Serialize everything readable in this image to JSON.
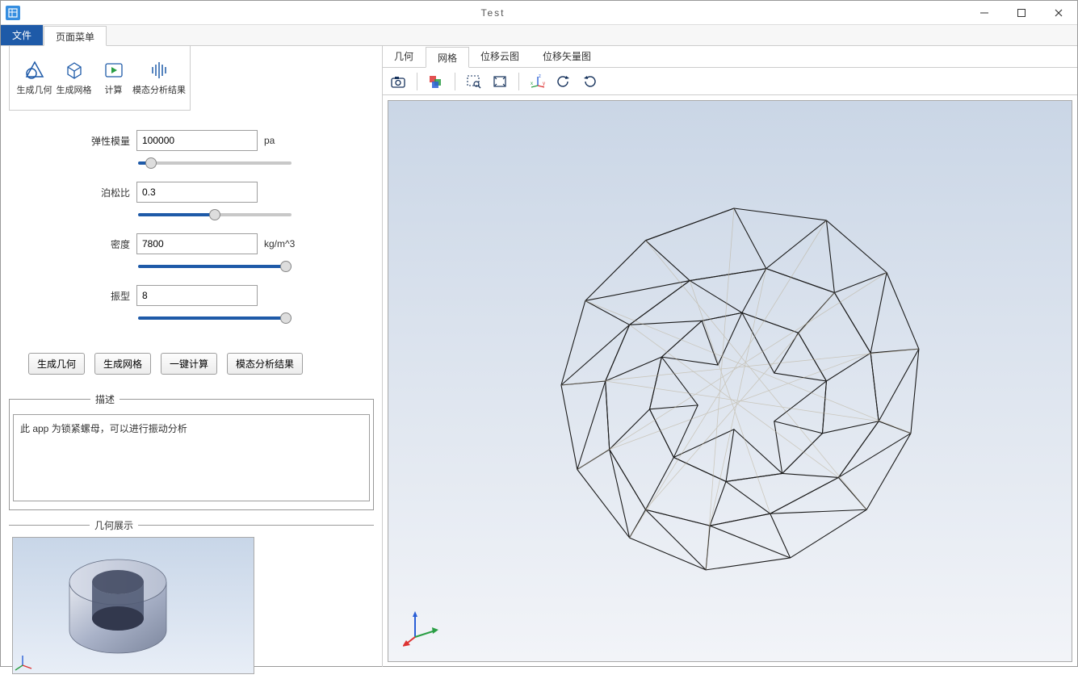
{
  "window": {
    "title": "Test"
  },
  "menuTabs": {
    "file": "文件",
    "page": "页面菜单"
  },
  "ribbon": {
    "genGeom": "生成几何",
    "genMesh": "生成网格",
    "compute": "计算",
    "modalResult": "模态分析结果"
  },
  "params": {
    "elastic": {
      "label": "弹性模量",
      "value": "100000",
      "unit": "pa",
      "slider": 5
    },
    "poisson": {
      "label": "泊松比",
      "value": "0.3",
      "unit": "",
      "slider": 50
    },
    "density": {
      "label": "密度",
      "value": "7800",
      "unit": "kg/m^3",
      "slider": 100
    },
    "mode": {
      "label": "振型",
      "value": "8",
      "unit": "",
      "slider": 100
    }
  },
  "buttons": {
    "genGeom": "生成几何",
    "genMesh": "生成网格",
    "oneKey": "一键计算",
    "modalResult": "模态分析结果"
  },
  "desc": {
    "legend": "描述",
    "text": "此 app 为锁紧螺母，可以进行振动分析"
  },
  "geomPreview": {
    "legend": "几何展示"
  },
  "viewTabs": {
    "geometry": "几何",
    "mesh": "网格",
    "dispCloud": "位移云图",
    "dispVector": "位移矢量图"
  }
}
